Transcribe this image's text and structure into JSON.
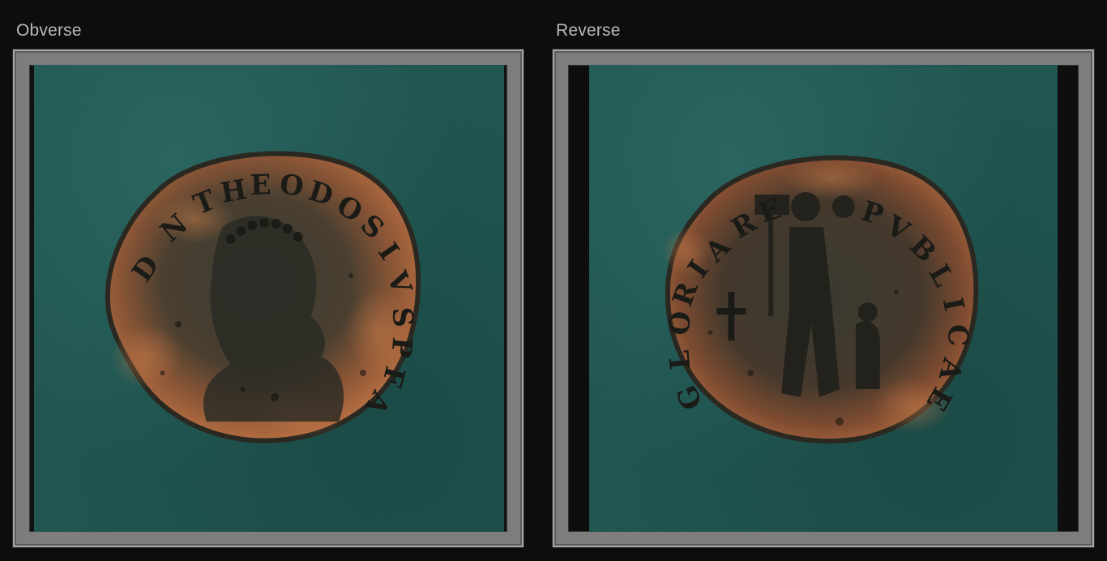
{
  "obverse": {
    "caption": "Obverse"
  },
  "reverse": {
    "caption": "Reverse"
  },
  "colors": {
    "background": "#0d0d0d",
    "frame": "#7d7d7d",
    "felt": "#1f5550",
    "coin_patina": "#3a3a2e",
    "coin_rust": "#b06a42",
    "caption_text": "#b9b9b9"
  }
}
